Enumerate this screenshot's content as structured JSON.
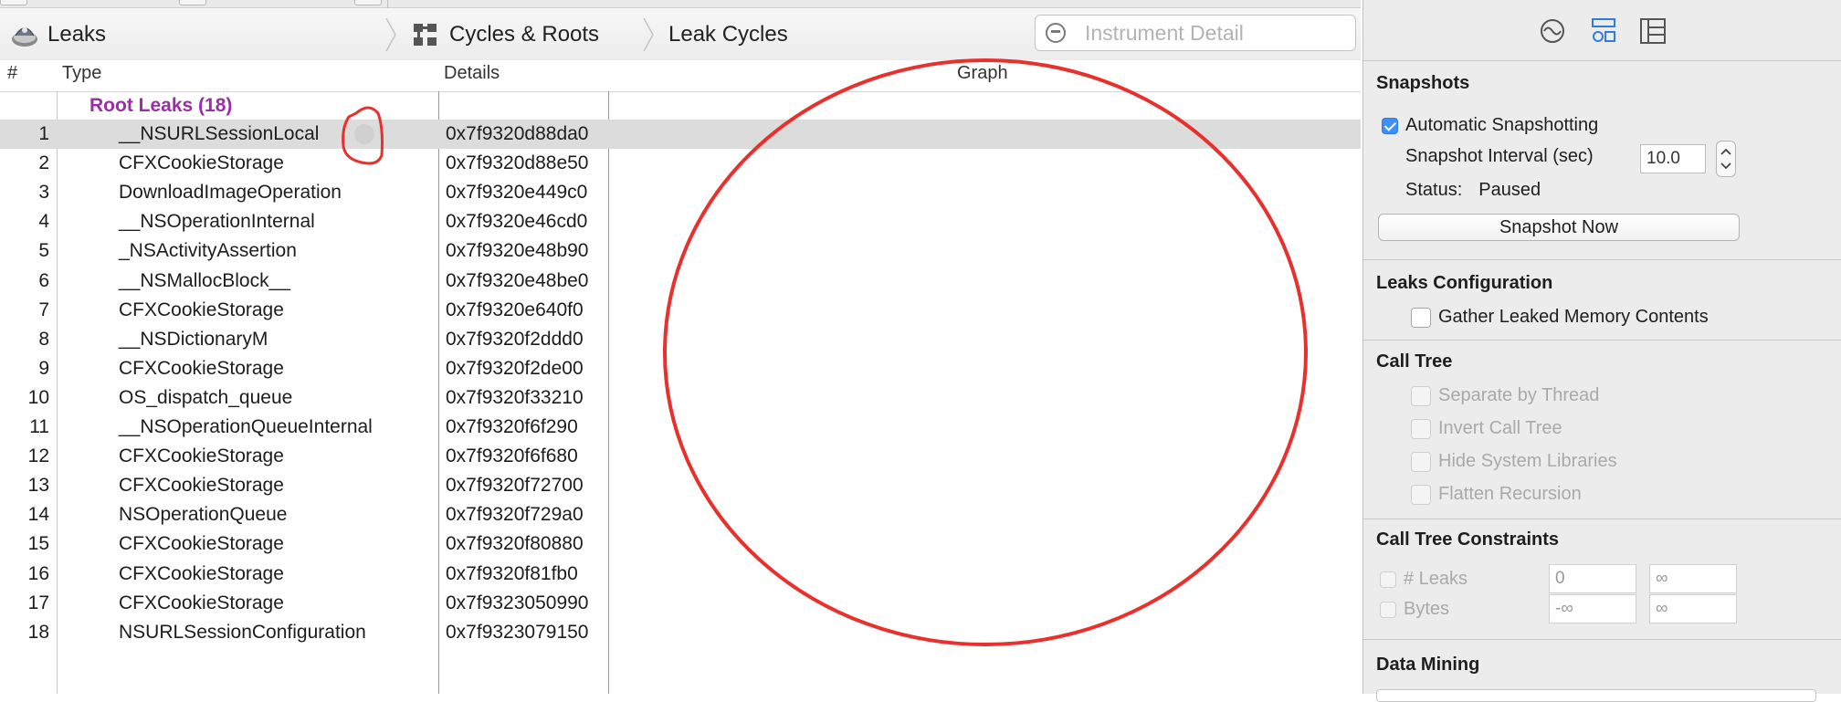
{
  "jumpbar": {
    "instrument_label": "Leaks",
    "view_label": "Cycles & Roots",
    "subview_label": "Leak Cycles",
    "search_placeholder": "Instrument Detail"
  },
  "table": {
    "columns": {
      "num": "#",
      "type": "Type",
      "details": "Details",
      "graph": "Graph"
    },
    "group_label": "Root Leaks (18)",
    "rows": [
      {
        "num": "1",
        "type": "__NSURLSessionLocal",
        "details": "0x7f9320d88da0"
      },
      {
        "num": "2",
        "type": "CFXCookieStorage",
        "details": "0x7f9320d88e50"
      },
      {
        "num": "3",
        "type": "DownloadImageOperation",
        "details": "0x7f9320e449c0"
      },
      {
        "num": "4",
        "type": "__NSOperationInternal",
        "details": "0x7f9320e46cd0"
      },
      {
        "num": "5",
        "type": "_NSActivityAssertion",
        "details": "0x7f9320e48b90"
      },
      {
        "num": "6",
        "type": "__NSMallocBlock__",
        "details": "0x7f9320e48be0"
      },
      {
        "num": "7",
        "type": "CFXCookieStorage",
        "details": "0x7f9320e640f0"
      },
      {
        "num": "8",
        "type": "__NSDictionaryM",
        "details": "0x7f9320f2ddd0"
      },
      {
        "num": "9",
        "type": "CFXCookieStorage",
        "details": "0x7f9320f2de00"
      },
      {
        "num": "10",
        "type": "OS_dispatch_queue",
        "details": "0x7f9320f33210"
      },
      {
        "num": "11",
        "type": "__NSOperationQueueInternal",
        "details": "0x7f9320f6f290"
      },
      {
        "num": "12",
        "type": "CFXCookieStorage",
        "details": "0x7f9320f6f680"
      },
      {
        "num": "13",
        "type": "CFXCookieStorage",
        "details": "0x7f9320f72700"
      },
      {
        "num": "14",
        "type": "NSOperationQueue",
        "details": "0x7f9320f729a0"
      },
      {
        "num": "15",
        "type": "CFXCookieStorage",
        "details": "0x7f9320f80880"
      },
      {
        "num": "16",
        "type": "CFXCookieStorage",
        "details": "0x7f9320f81fb0"
      },
      {
        "num": "17",
        "type": "CFXCookieStorage",
        "details": "0x7f9323050990"
      },
      {
        "num": "18",
        "type": "NSURLSessionConfiguration",
        "details": "0x7f9323079150"
      }
    ]
  },
  "inspector": {
    "snapshots": {
      "title": "Snapshots",
      "automatic_label": "Automatic Snapshotting",
      "automatic_checked": true,
      "interval_label": "Snapshot Interval (sec)",
      "interval_value": "10.0",
      "status_label": "Status:",
      "status_value": "Paused",
      "snapshot_now_label": "Snapshot Now"
    },
    "leaks_config": {
      "title": "Leaks Configuration",
      "gather_label": "Gather Leaked Memory Contents"
    },
    "call_tree": {
      "title": "Call Tree",
      "options": [
        "Separate by Thread",
        "Invert Call Tree",
        "Hide System Libraries",
        "Flatten Recursion"
      ]
    },
    "constraints": {
      "title": "Call Tree Constraints",
      "leaks_label": "# Leaks",
      "leaks_min": "0",
      "leaks_max": "∞",
      "bytes_label": "Bytes",
      "bytes_min": "-∞",
      "bytes_max": "∞"
    },
    "data_mining": {
      "title": "Data Mining"
    }
  },
  "colors": {
    "group_label": "#9a2ea6",
    "selection": "#dcdcdc",
    "checkbox_accent": "#3d8ff5",
    "annotation": "#e8302c"
  }
}
